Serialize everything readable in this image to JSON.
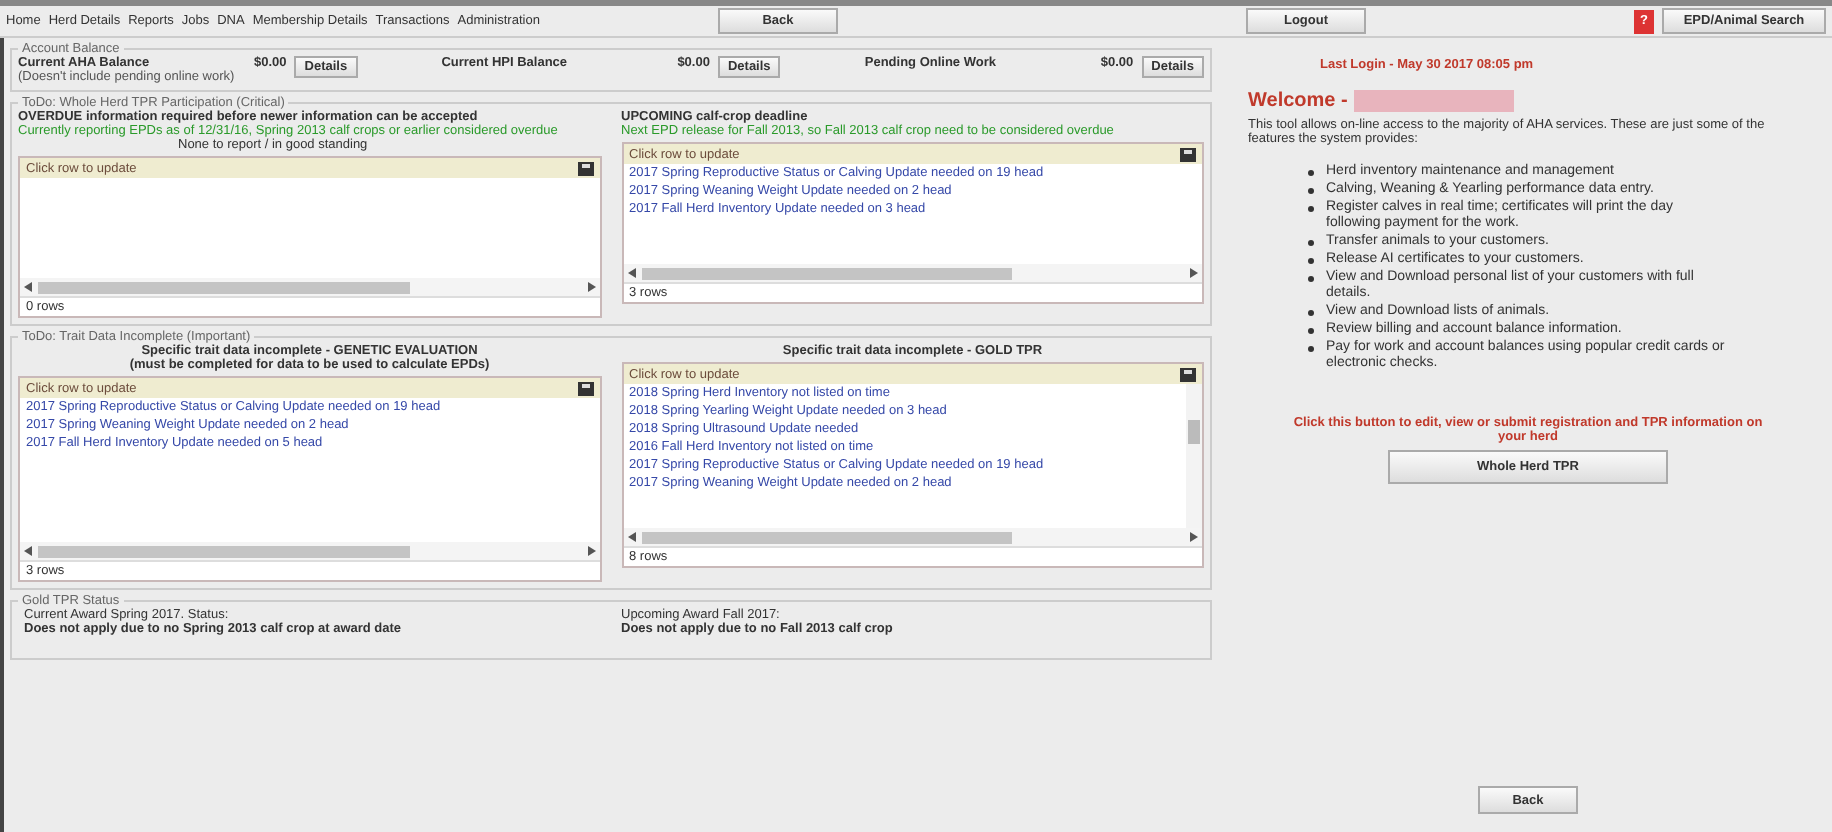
{
  "nav": {
    "links": [
      "Home",
      "Herd Details",
      "Reports",
      "Jobs",
      "DNA",
      "Membership Details",
      "Transactions",
      "Administration"
    ],
    "back": "Back",
    "logout": "Logout",
    "help": "?",
    "search": "EPD/Animal Search"
  },
  "account": {
    "legend": "Account Balance",
    "items": [
      {
        "label": "Current AHA Balance",
        "note": "(Doesn't include pending online work)",
        "amount": "$0.00",
        "button": "Details"
      },
      {
        "label": "Current HPI Balance",
        "amount": "$0.00",
        "button": "Details"
      },
      {
        "label": "Pending Online Work",
        "amount": "$0.00",
        "button": "Details"
      }
    ]
  },
  "sections": [
    {
      "legend": "ToDo: Whole Herd TPR Participation (Critical)",
      "columns": [
        {
          "heading": "OVERDUE information required before newer information can be accepted",
          "note": "Currently reporting EPDs as of 12/31/16, Spring 2013 calf crops or earlier considered overdue",
          "status": "None to report / in good standing",
          "grid": {
            "header": "Click row to update",
            "footer": "0 rows"
          }
        },
        {
          "heading": "UPCOMING calf-crop deadline",
          "note": "Next EPD release for Fall 2013, so Fall 2013 calf crop need to be considered overdue",
          "grid": {
            "header": "Click row to update",
            "rows": [
              "2017 Spring Reproductive Status or Calving Update needed on 19 head",
              "2017 Spring Weaning Weight Update needed on 2 head",
              "2017 Fall Herd Inventory Update needed on 3 head"
            ],
            "footer": "3 rows"
          }
        }
      ]
    },
    {
      "legend": "ToDo: Trait Data Incomplete (Important)",
      "columns": [
        {
          "heading": "Specific trait data incomplete - GENETIC EVALUATION",
          "subheading": "(must be completed for data to be used to calculate EPDs)",
          "grid": {
            "header": "Click row to update",
            "rows": [
              "2017 Spring Reproductive Status or Calving Update needed on 19 head",
              "2017 Spring Weaning Weight Update needed on 2 head",
              "2017 Fall Herd Inventory Update needed on 5 head"
            ],
            "footer": "3 rows"
          }
        },
        {
          "heading": "Specific trait data incomplete - GOLD TPR",
          "grid": {
            "header": "Click row to update",
            "rows": [
              "2018 Spring Herd Inventory not listed on time",
              "2018 Spring Yearling Weight Update needed on 3 head",
              "2018 Spring Ultrasound Update needed",
              "2016 Fall Herd Inventory not listed on time",
              "2017 Spring Reproductive Status or Calving Update needed on 19 head",
              "2017 Spring Weaning Weight Update needed on 2 head"
            ],
            "footer": "8 rows",
            "vscroll": true
          }
        }
      ]
    }
  ],
  "gold": {
    "legend": "Gold TPR Status",
    "items": [
      {
        "label": "Current Award Spring 2017. Status:",
        "value": "Does not apply due to no Spring 2013 calf crop at award date"
      },
      {
        "label": "Upcoming Award Fall 2017:",
        "value": "Does not apply due to no Fall 2013 calf crop"
      }
    ]
  },
  "side": {
    "last_login": "Last Login - May 30 2017 08:05 pm",
    "welcome": "Welcome -",
    "intro": "This tool allows on-line access to the majority of AHA services. These are just some of the features the system provides:",
    "features": [
      "Herd inventory maintenance and management",
      "Calving, Weaning & Yearling performance data entry.",
      "Register calves in real time; certificates will print the day following payment for the work.",
      "Transfer animals to your customers.",
      "Release AI certificates to your customers.",
      "View and Download personal list of your customers with full details.",
      "View and Download lists of animals.",
      "Review billing and account balance information.",
      "Pay for work and account balances using popular credit cards or electronic checks."
    ],
    "prompt": "Click this button to edit, view or submit registration and TPR information on your herd",
    "tpr_button": "Whole Herd TPR",
    "back": "Back"
  }
}
